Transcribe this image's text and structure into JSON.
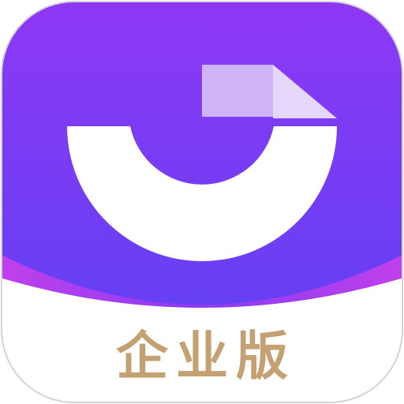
{
  "app_icon": {
    "name": "app-icon",
    "edition_label": "企业版",
    "logo": "document-arc-icon"
  },
  "colors": {
    "background_top": "#8e38f5",
    "background_bottom": "#6440f3",
    "wave_magenta": "#c040ec",
    "wave_purple": "#8a3cf1",
    "mark": "#ffffff",
    "doc_tile": "#cfb4fa",
    "doc_fold": "#e5d7fc",
    "label": "#c4a172",
    "plate": "#ffffff",
    "border": "#d4d4d4"
  }
}
